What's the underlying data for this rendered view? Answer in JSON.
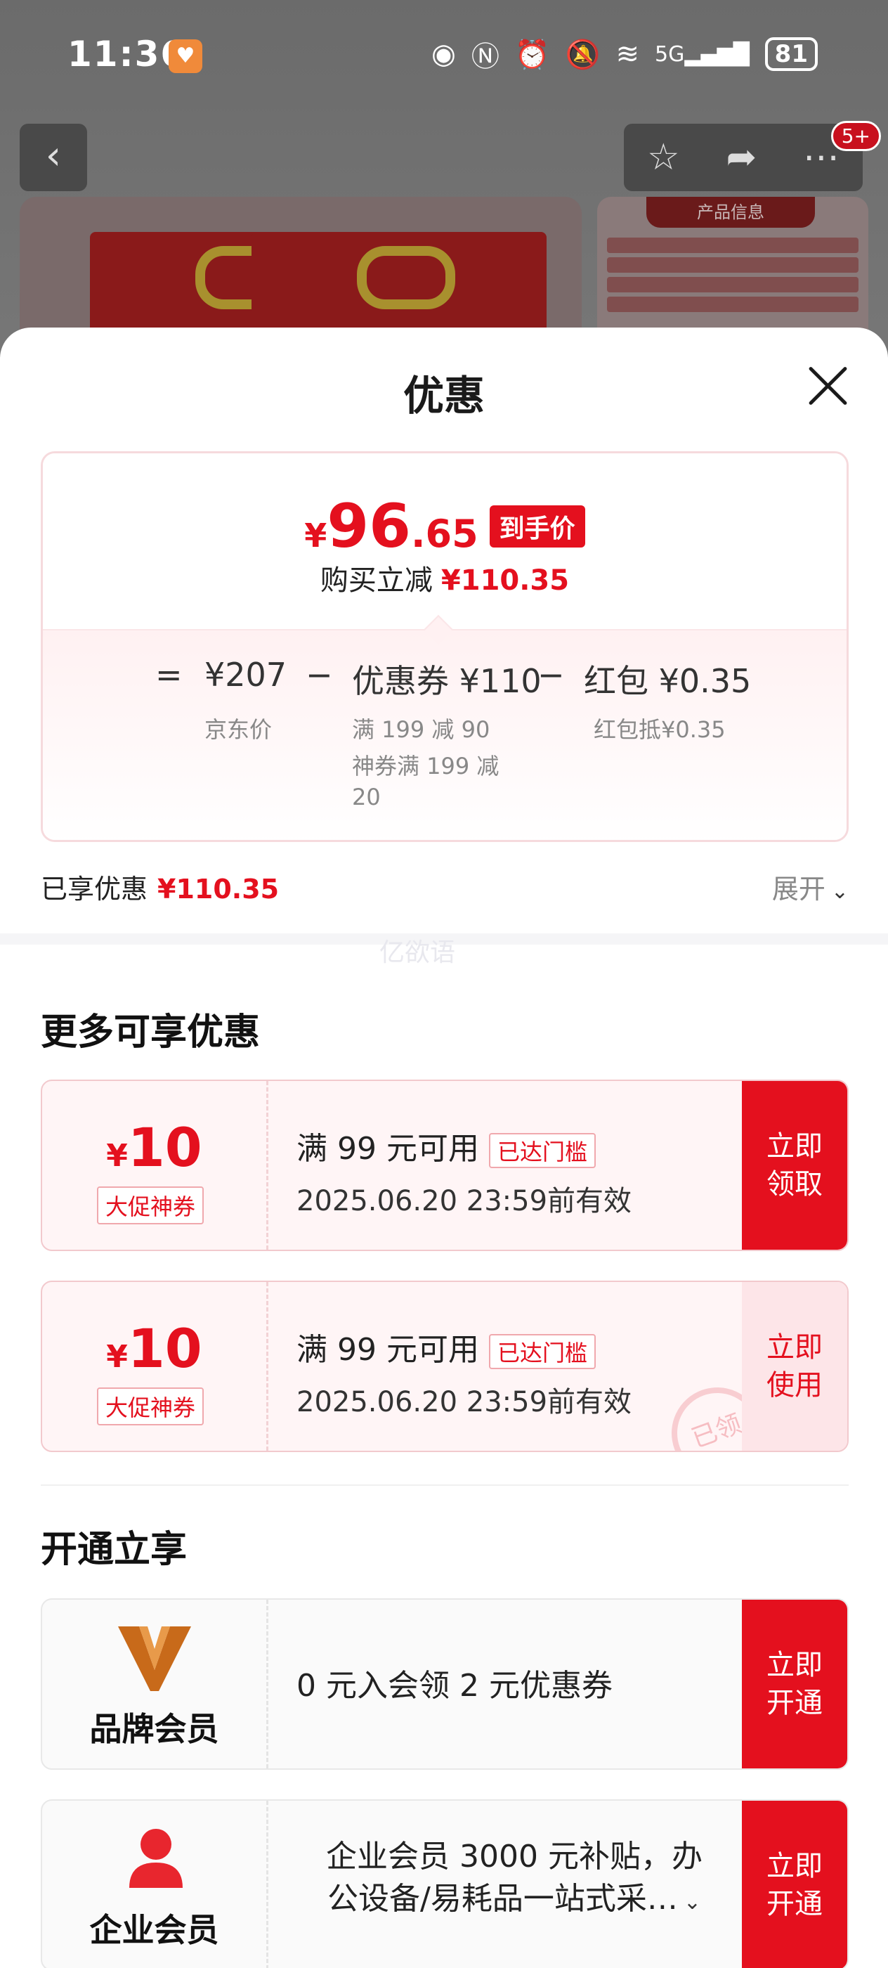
{
  "status_bar": {
    "time": "11:36",
    "network": "5G",
    "battery": "81"
  },
  "top_nav": {
    "message_count": "5+"
  },
  "info_card": {
    "title": "产品信息"
  },
  "sheet": {
    "title": "优惠",
    "price": {
      "currency": "¥",
      "integer": "96",
      "decimal": ".65",
      "tag": "到手价",
      "reduce_label": "购买立减",
      "reduce_amount": "¥110.35"
    },
    "formula": {
      "eq": "=",
      "jd_price": "¥207",
      "jd_label": "京东价",
      "minus1": "−",
      "coupon_label": "优惠券 ¥110",
      "coupon_sub1": "满 199 减 90",
      "coupon_sub2": "神券满 199 减",
      "coupon_sub3": "20",
      "minus2": "−",
      "redpacket_label": "红包 ¥0.35",
      "redpacket_sub": "红包抵¥0.35"
    },
    "enjoyed": {
      "label": "已享优惠",
      "amount": "¥110.35",
      "expand": "展开"
    },
    "watermark": "亿欲语",
    "more_title": "更多可享优惠",
    "coupons": [
      {
        "currency": "¥",
        "amount": "10",
        "tag": "大促神券",
        "condition": "满 99 元可用",
        "reach": "已达门槛",
        "valid": "2025.06.20 23:59前有效",
        "action": "立即领取",
        "action_l1": "立即",
        "action_l2": "领取"
      },
      {
        "currency": "¥",
        "amount": "10",
        "tag": "大促神券",
        "condition": "满 99 元可用",
        "reach": "已达门槛",
        "valid": "2025.06.20 23:59前有效",
        "action_l1": "立即",
        "action_l2": "使用",
        "stamp": "已领"
      }
    ],
    "open_title": "开通立享",
    "members": [
      {
        "name": "品牌会员",
        "desc": "0 元入会领 2 元优惠券",
        "action_l1": "立即",
        "action_l2": "开通"
      },
      {
        "name": "企业会员",
        "desc_l1": "企业会员 3000 元补贴，办",
        "desc_l2": "公设备/易耗品一站式采…",
        "action_l1": "立即",
        "action_l2": "开通"
      }
    ]
  },
  "colors": {
    "accent": "#e4101e",
    "coupon_bg": "#fff5f6"
  }
}
